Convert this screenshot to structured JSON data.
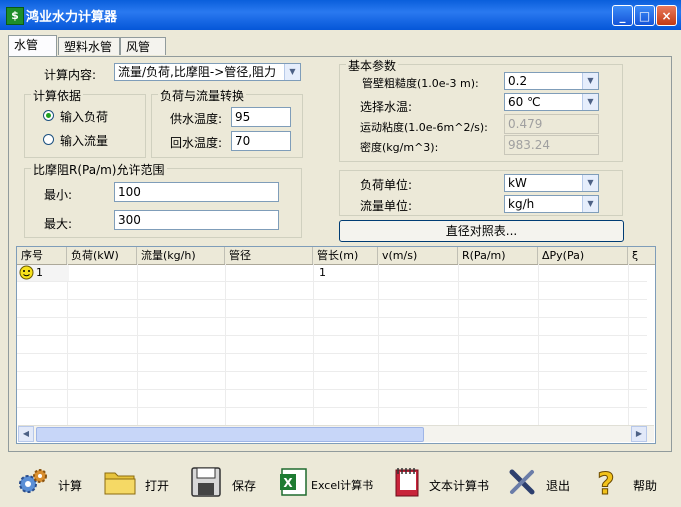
{
  "window": {
    "title": "鸿业水力计算器",
    "minimize": "_",
    "maximize": "□",
    "close": "×"
  },
  "tabs": [
    "水管",
    "塑料水管",
    "风管"
  ],
  "calc": {
    "label": "计算内容:",
    "value": "流量/负荷,比摩阻->管径,阻力"
  },
  "basis": {
    "title": "计算依据",
    "opt_load": "输入负荷",
    "opt_flow": "输入流量",
    "selected": "输入负荷"
  },
  "conv": {
    "title": "负荷与流量转换",
    "supply_label": "供水温度:",
    "supply_value": "95",
    "return_label": "回水温度:",
    "return_value": "70"
  },
  "range": {
    "title": "比摩阻R(Pa/m)允许范围",
    "min_label": "最小:",
    "min_value": "100",
    "max_label": "最大:",
    "max_value": "300"
  },
  "basic": {
    "title": "基本参数",
    "rough_label": "管壁粗糙度(1.0e-3 m):",
    "rough_value": "0.2",
    "temp_label": "选择水温:",
    "temp_value": "60  ℃",
    "visc_label": "运动粘度(1.0e-6m^2/s):",
    "visc_value": "0.479",
    "dens_label": "密度(kg/m^3):",
    "dens_value": "983.24"
  },
  "units": {
    "load_label": "负荷单位:",
    "load_value": "kW",
    "flow_label": "流量单位:",
    "flow_value": "kg/h"
  },
  "diameter_btn": "直径对照表...",
  "grid": {
    "headers": [
      "序号",
      "负荷(kW)",
      "流量(kg/h)",
      "管径",
      "管长(m)",
      "v(m/s)",
      "R(Pa/m)",
      "ΔPy(Pa)",
      "ξ"
    ],
    "rows": [
      {
        "no": "1",
        "length": "1",
        "row_icon": "smiley-icon"
      }
    ]
  },
  "toolbar": [
    {
      "label": "计算",
      "icon": "calculate-gears-icon"
    },
    {
      "label": "打开",
      "icon": "open-folder-icon"
    },
    {
      "label": "保存",
      "icon": "save-floppy-icon"
    },
    {
      "label": "Excel计算书",
      "icon": "excel-icon"
    },
    {
      "label": "文本计算书",
      "icon": "text-book-icon"
    },
    {
      "label": "退出",
      "icon": "exit-tools-icon"
    },
    {
      "label": "帮助",
      "icon": "help-icon"
    }
  ]
}
